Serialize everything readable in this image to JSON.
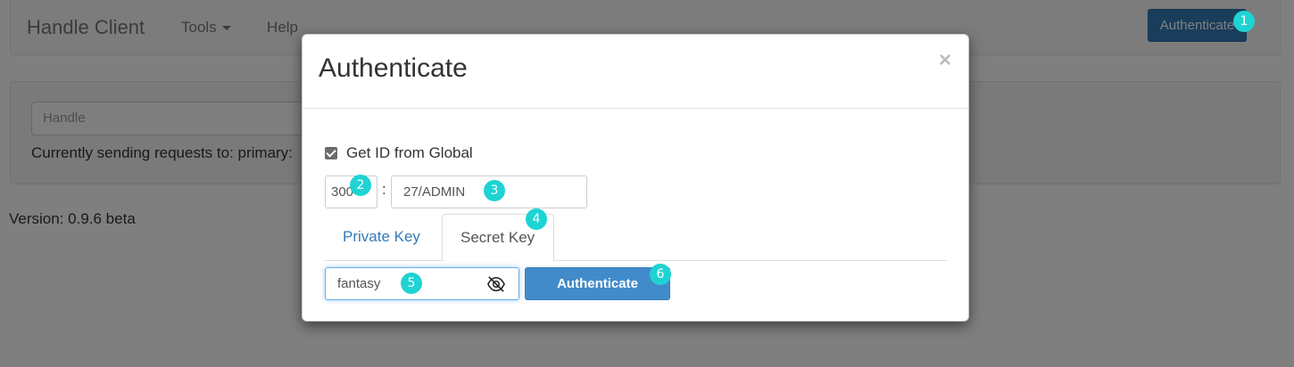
{
  "app": {
    "brand": "Handle Client",
    "nav_tools": "Tools",
    "nav_help": "Help",
    "nav_authenticate": "Authenticate"
  },
  "main": {
    "handle_placeholder": "Handle",
    "sending_text": "Currently sending requests to: primary:",
    "version": "Version: 0.9.6 beta"
  },
  "modal": {
    "title": "Authenticate",
    "close": "×",
    "checkbox_label": "Get ID from Global",
    "checkbox_checked": true,
    "id_prefix": "300",
    "colon": ":",
    "id_suffix": "27/ADMIN",
    "tabs": [
      {
        "label": "Private Key",
        "active": false
      },
      {
        "label": "Secret Key",
        "active": true
      }
    ],
    "secret_value": "fantasy",
    "visibility_icon": "eye-slash-icon",
    "authenticate_button": "Authenticate"
  },
  "markers": [
    "1",
    "2",
    "3",
    "4",
    "5",
    "6"
  ],
  "colors": {
    "primary": "#337ab7",
    "marker": "#1fd3d3",
    "focus": "#66afe9"
  }
}
